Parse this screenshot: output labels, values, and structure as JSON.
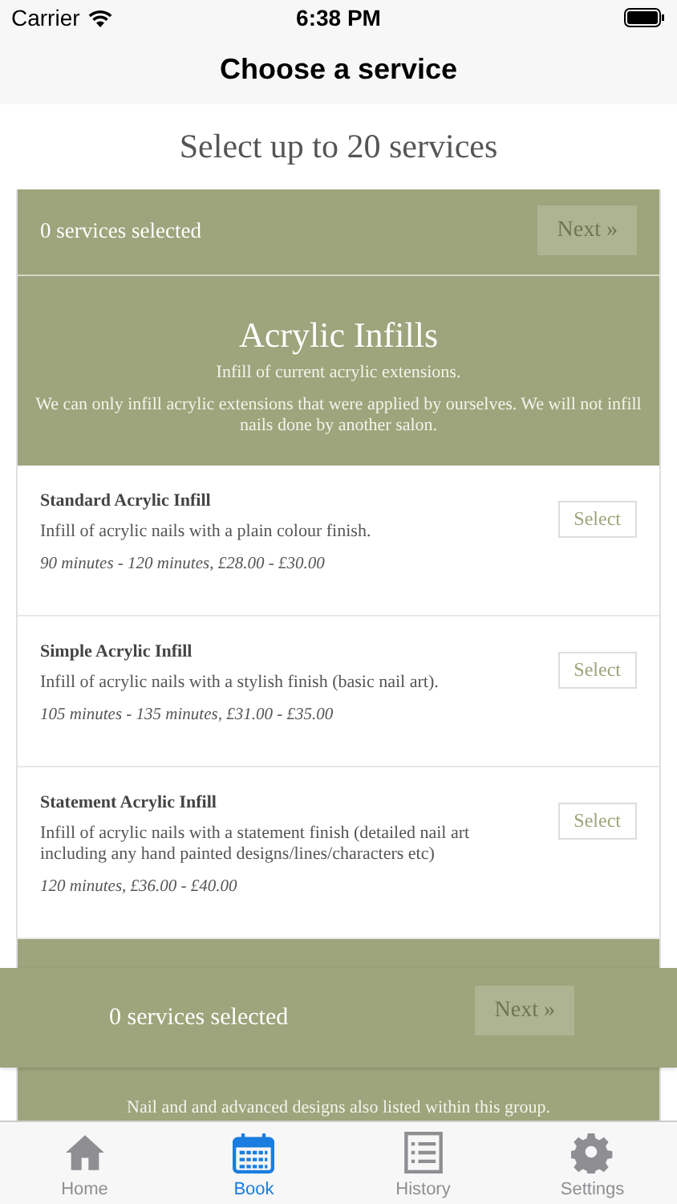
{
  "status_bar": {
    "carrier": "Carrier",
    "time": "6:38 PM"
  },
  "nav_title": "Choose a service",
  "instruction": "Select up to 20 services",
  "selection_bar": {
    "count": "0 services selected",
    "next_label": "Next »",
    "next_disabled": true
  },
  "groups": [
    {
      "title": "Acrylic Infills",
      "subtitle": "Infill of current acrylic extensions.",
      "note": "We can only infill acrylic extensions that were applied by ourselves. We will not infill nails done by another salon.",
      "services": [
        {
          "name": "Standard Acrylic Infill",
          "description": "Infill of acrylic nails with a plain colour finish.",
          "details": "90 minutes - 120 minutes, £28.00 - £30.00",
          "action": "Select",
          "selected": false
        },
        {
          "name": "Simple Acrylic Infill",
          "description": "Infill of acrylic nails with a stylish finish (basic nail art).",
          "details": "105 minutes - 135 minutes, £31.00 - £35.00",
          "action": "Select",
          "selected": false
        },
        {
          "name": "Statement Acrylic Infill",
          "description": "Infill of acrylic nails with a statement finish (detailed nail art including any hand painted designs/lines/characters etc)",
          "details": "120 minutes, £36.00 - £40.00",
          "action": "Select",
          "selected": false
        }
      ]
    },
    {
      "note": "Nail and and advanced designs also listed within this group."
    }
  ],
  "floating_bar": {
    "count": "0 services selected",
    "next_label": "Next »",
    "next_disabled": true
  },
  "tab_bar": [
    {
      "label": "Home",
      "kind": "home",
      "selected": false
    },
    {
      "label": "Book",
      "kind": "calendar",
      "selected": true
    },
    {
      "label": "History",
      "kind": "list",
      "selected": false
    },
    {
      "label": "Settings",
      "kind": "gear",
      "selected": false
    }
  ]
}
